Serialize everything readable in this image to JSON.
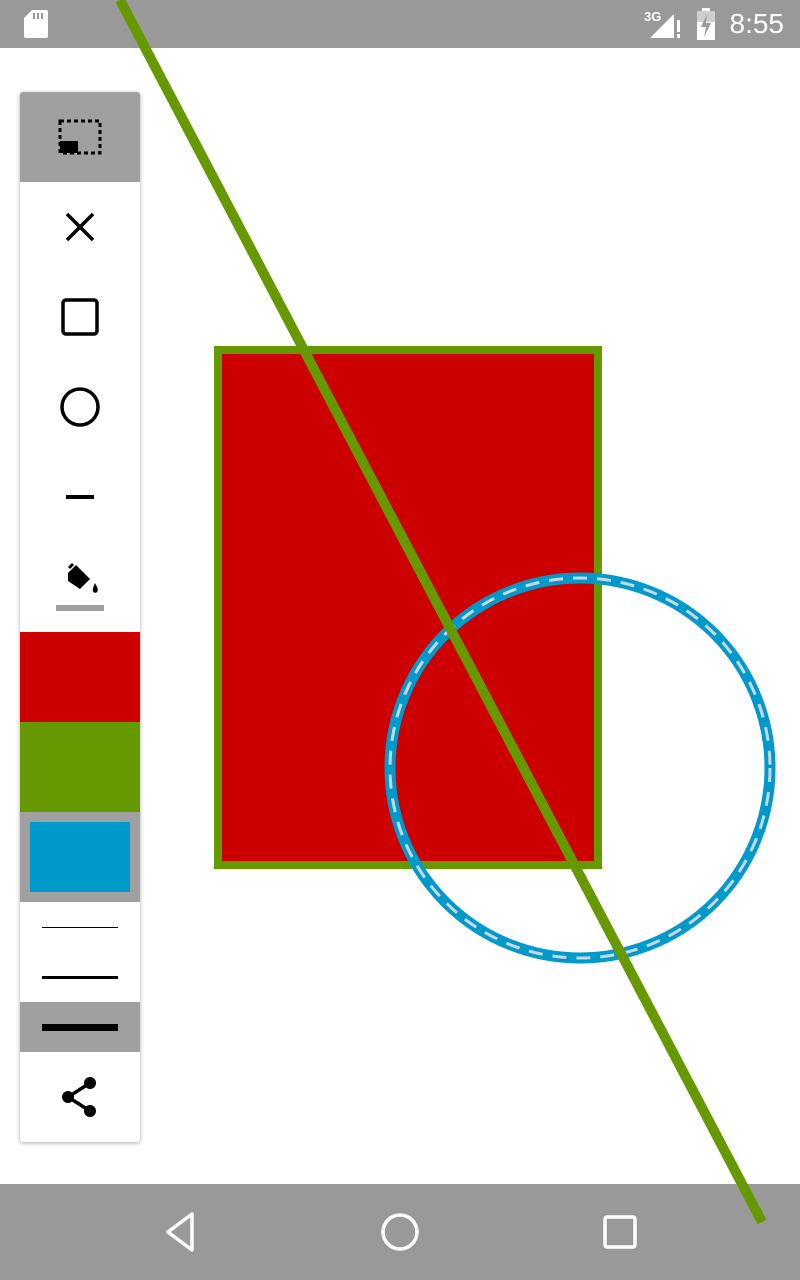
{
  "status_bar": {
    "network_label": "3G",
    "time": "8:55",
    "icons": [
      "sd-card-icon",
      "signal-icon",
      "battery-icon"
    ]
  },
  "toolbar": {
    "tools": [
      {
        "name": "select-tool",
        "icon": "select-rectangle-icon",
        "selected": true
      },
      {
        "name": "clear-tool",
        "icon": "close-icon",
        "selected": false
      },
      {
        "name": "rectangle-tool",
        "icon": "square-icon",
        "selected": false
      },
      {
        "name": "circle-tool",
        "icon": "circle-icon",
        "selected": false
      },
      {
        "name": "line-tool",
        "icon": "line-icon",
        "selected": false
      },
      {
        "name": "fill-tool",
        "icon": "paint-bucket-icon",
        "selected": false
      }
    ],
    "colors": [
      {
        "name": "red",
        "hex": "#cc0000",
        "selected": false
      },
      {
        "name": "green",
        "hex": "#669900",
        "selected": false
      },
      {
        "name": "blue",
        "hex": "#0099cc",
        "selected": true
      }
    ],
    "stroke_widths": [
      {
        "name": "thin",
        "selected": false
      },
      {
        "name": "medium",
        "selected": false
      },
      {
        "name": "thick",
        "selected": true
      }
    ],
    "share": {
      "icon": "share-icon"
    }
  },
  "canvas_shapes": {
    "rectangle": {
      "fill": "#cc0000",
      "stroke": "#669900"
    },
    "circle": {
      "fill": "none",
      "stroke": "#0099cc",
      "dash_color": "#c8d8e0"
    },
    "line": {
      "stroke": "#669900"
    }
  },
  "nav_bar": {
    "icons": [
      "back-icon",
      "home-icon",
      "recents-icon"
    ]
  }
}
